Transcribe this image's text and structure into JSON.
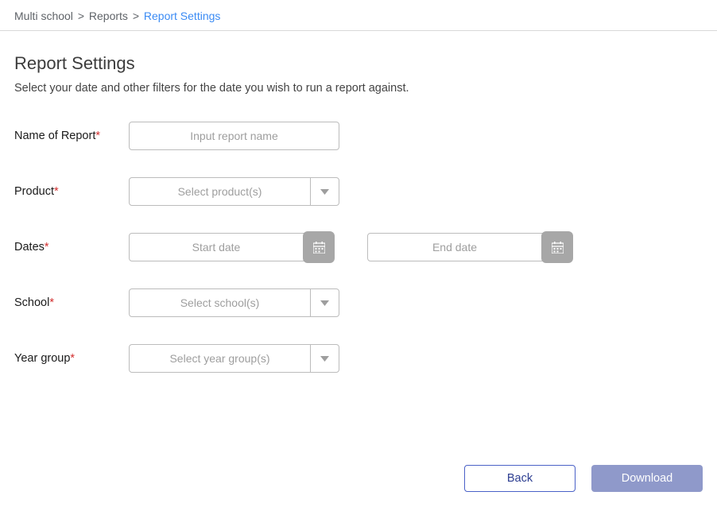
{
  "breadcrumb": {
    "item1": "Multi school",
    "item2": "Reports",
    "item3": "Report Settings"
  },
  "header": {
    "title": "Report Settings",
    "subtitle": "Select your date and other filters for the date you wish to run a report against."
  },
  "form": {
    "name": {
      "label": "Name of Report",
      "placeholder": "Input report name",
      "value": ""
    },
    "product": {
      "label": "Product",
      "placeholder": "Select product(s)"
    },
    "dates": {
      "label": "Dates",
      "start_placeholder": "Start date",
      "end_placeholder": "End date"
    },
    "school": {
      "label": "School",
      "placeholder": "Select school(s)"
    },
    "year_group": {
      "label": "Year group",
      "placeholder": "Select year group(s)"
    }
  },
  "buttons": {
    "back": "Back",
    "download": "Download"
  }
}
